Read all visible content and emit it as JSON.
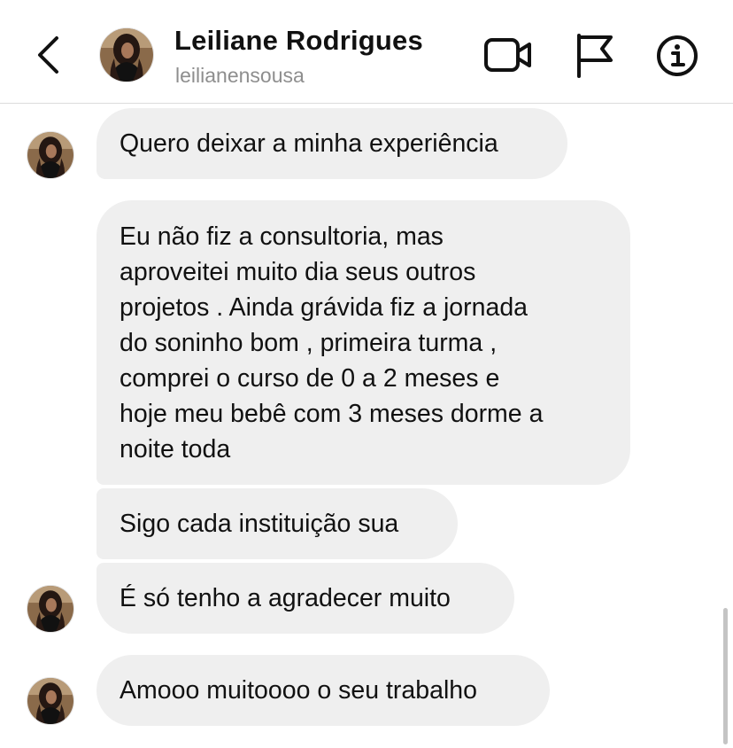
{
  "header": {
    "name": "Leiliane Rodrigues",
    "username": "leilianensousa",
    "icons": {
      "back": "chevron-left-icon",
      "video": "video-camera-icon",
      "flag": "flag-icon",
      "info": "info-icon"
    }
  },
  "messages": [
    {
      "lines": [
        "Quero deixar a minha experiência"
      ],
      "avatar": true
    },
    {
      "lines": [
        "Eu não fiz a consultoria, mas",
        "aproveitei muito dia seus outros",
        "projetos . Ainda grávida fiz a jornada",
        "do soninho bom , primeira turma ,",
        "comprei o curso de 0 a 2 meses e",
        "hoje meu bebê com 3 meses dorme a",
        "noite toda"
      ],
      "avatar": false
    },
    {
      "lines": [
        "Sigo cada instituição sua"
      ],
      "avatar": false
    },
    {
      "lines": [
        "É só tenho a agradecer muito"
      ],
      "avatar": true
    },
    {
      "lines": [
        "Amooo muitoooo o seu trabalho"
      ],
      "avatar": true
    }
  ],
  "colors": {
    "bubble": "#efefef",
    "text": "#111111",
    "muted": "#8e8e8e",
    "divider": "#dcdcdc"
  }
}
